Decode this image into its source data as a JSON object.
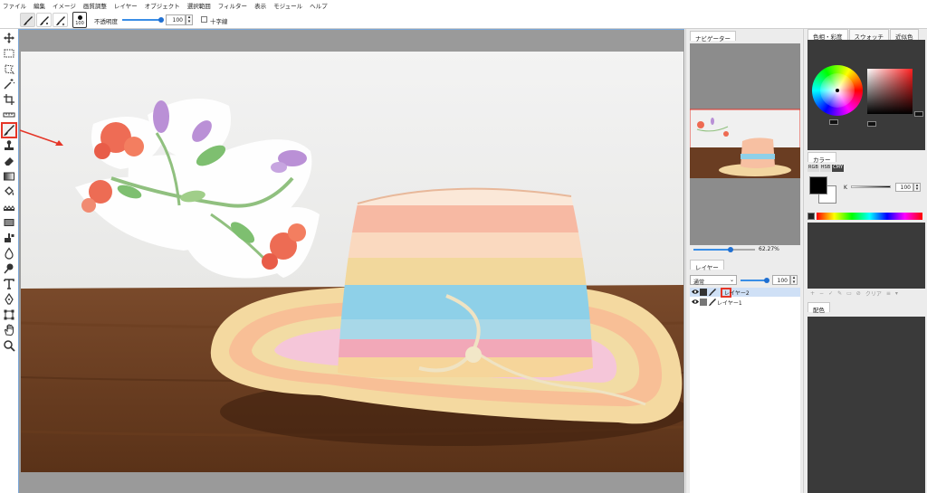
{
  "menu": [
    "ファイル",
    "編集",
    "イメージ",
    "画質調整",
    "レイヤー",
    "オブジェクト",
    "選択範囲",
    "フィルター",
    "表示",
    "モジュール",
    "ヘルプ"
  ],
  "options": {
    "brush_size": "100",
    "opacity_label": "不透明度",
    "opacity_value": "100",
    "crosshair_label": "十字線"
  },
  "tools": [
    "move-icon",
    "marquee-icon",
    "lasso-icon",
    "magic-wand-icon",
    "crop-icon",
    "ruler-icon",
    "brush-icon",
    "stamp-icon",
    "eraser-icon",
    "gradient-icon",
    "fill-icon",
    "pattern-icon",
    "rectangle-icon",
    "smudge-icon",
    "drop-icon",
    "dodge-icon",
    "text-icon",
    "pen-icon",
    "transform-icon",
    "hand-icon",
    "zoom-icon"
  ],
  "active_tool": "brush-icon",
  "navigator": {
    "tab": "ナビゲーター",
    "zoom": "62.27%"
  },
  "layers": {
    "tab": "レイヤー",
    "blend_mode": "通常",
    "opacity": "100",
    "rows": [
      {
        "name": "レイヤー2",
        "selected": true
      },
      {
        "name": "レイヤー1",
        "selected": false
      }
    ]
  },
  "color_panel": {
    "tabs": [
      "色相・彩度",
      "スウォッチ",
      "近似色"
    ],
    "active_tab": "色相・彩度",
    "wheel_value": "0",
    "sv_value_left": "0",
    "sv_value_right": "0"
  },
  "color": {
    "tab": "カラー",
    "modes": [
      "RGB",
      "HSB",
      "CMY"
    ],
    "active_mode": "CMY",
    "k_label": "K",
    "k_value": "100",
    "fg_color": "#000000",
    "bg_color": "#ffffff"
  },
  "swatch_toolbar": [
    "+",
    "−",
    "✓",
    "✎",
    "▭",
    "⊘",
    "クリア",
    "≡",
    "▾"
  ],
  "scheme": {
    "tab": "配色"
  }
}
